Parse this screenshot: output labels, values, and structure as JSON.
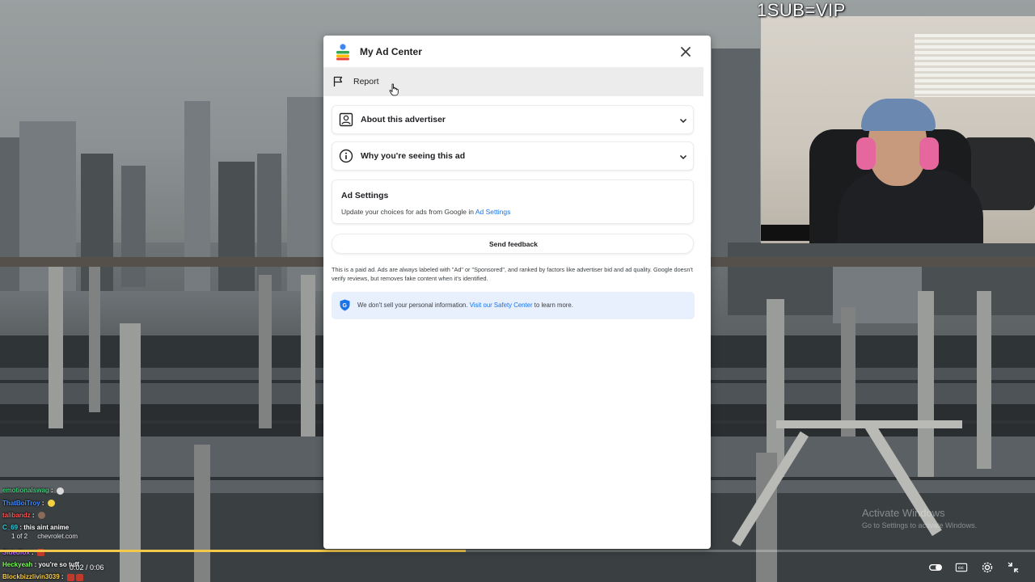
{
  "overlay": {
    "stream_text": "1SUB=VIP"
  },
  "modal": {
    "title": "My Ad Center",
    "report_label": "Report",
    "sections": [
      {
        "label": "About this advertiser"
      },
      {
        "label": "Why you're seeing this ad"
      }
    ],
    "ad_settings": {
      "heading": "Ad Settings",
      "desc_prefix": "Update your choices for ads from Google in ",
      "link_label": "Ad Settings"
    },
    "feedback_label": "Send feedback",
    "disclaimer": "This is a paid ad. Ads are always labeled with \"Ad\" or \"Sponsored\", and ranked by factors like advertiser bid and ad quality. Google doesn't verify reviews, but removes fake content when it's identified.",
    "privacy": {
      "prefix": "We don't sell your personal information. ",
      "link_label": "Visit our Safety Center",
      "suffix": " to learn more."
    }
  },
  "chat": {
    "messages": [
      {
        "user": "emotionalswag",
        "message": "",
        "color": "#3fd07c"
      },
      {
        "user": "ThatBoiTroy",
        "message": "",
        "color": "#3f8cff"
      },
      {
        "user": "talibandz",
        "message": "",
        "color": "#ff5a5a"
      },
      {
        "user": "C_69",
        "message": "this aint anime",
        "color": "#2fd0e0"
      },
      {
        "user": "Sidedfox",
        "message": "",
        "color": "#c06bff"
      },
      {
        "user": "Heckyeah",
        "message": "you're so tuff",
        "color": "#7cff5a"
      },
      {
        "user": "Blockbizzlivin3039",
        "message": "",
        "color": "#ffd24a"
      }
    ]
  },
  "player": {
    "ad_counter": "1 of 2",
    "ad_domain": "chevrolet.com",
    "time": "0:02 / 0:06",
    "progress_fraction": 0.45
  },
  "watermark": {
    "line1": "Activate Windows",
    "line2": "Go to Settings to activate Windows."
  },
  "colors": {
    "accent_link": "#1a73e8",
    "privacy_bg": "#e8f0fe",
    "progress": "#f2c94c"
  }
}
